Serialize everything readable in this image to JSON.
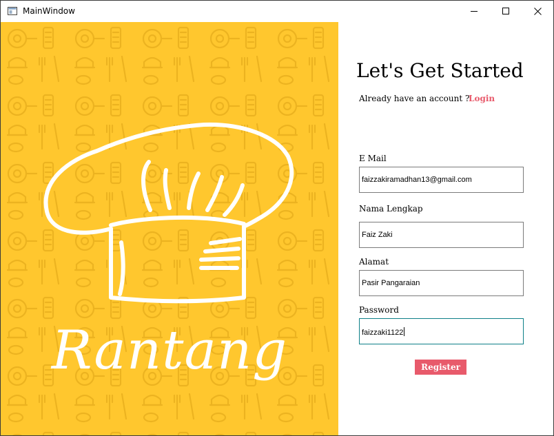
{
  "window": {
    "title": "MainWindow",
    "controls": [
      "minimize-icon",
      "maximize-icon",
      "close-icon"
    ]
  },
  "brand": {
    "name": "Rantang",
    "logo": "chef-hat-icon",
    "panel_color": "#ffc72e"
  },
  "form": {
    "heading": "Let's Get Started",
    "have_account": "Already have an account ?",
    "login_link": "Login",
    "email_label": "E Mail",
    "email_value": "faizzakiramadhan13@gmail.com",
    "name_label": "Nama Lengkap",
    "name_value": "Faiz Zaki",
    "address_label": "Alamat",
    "address_value": "Pasir Pangaraian",
    "password_label": "Password",
    "password_value": "faizzaki1122",
    "register_label": "Register",
    "accent_color": "#e85a6b",
    "focus_color": "#0b7f87"
  }
}
